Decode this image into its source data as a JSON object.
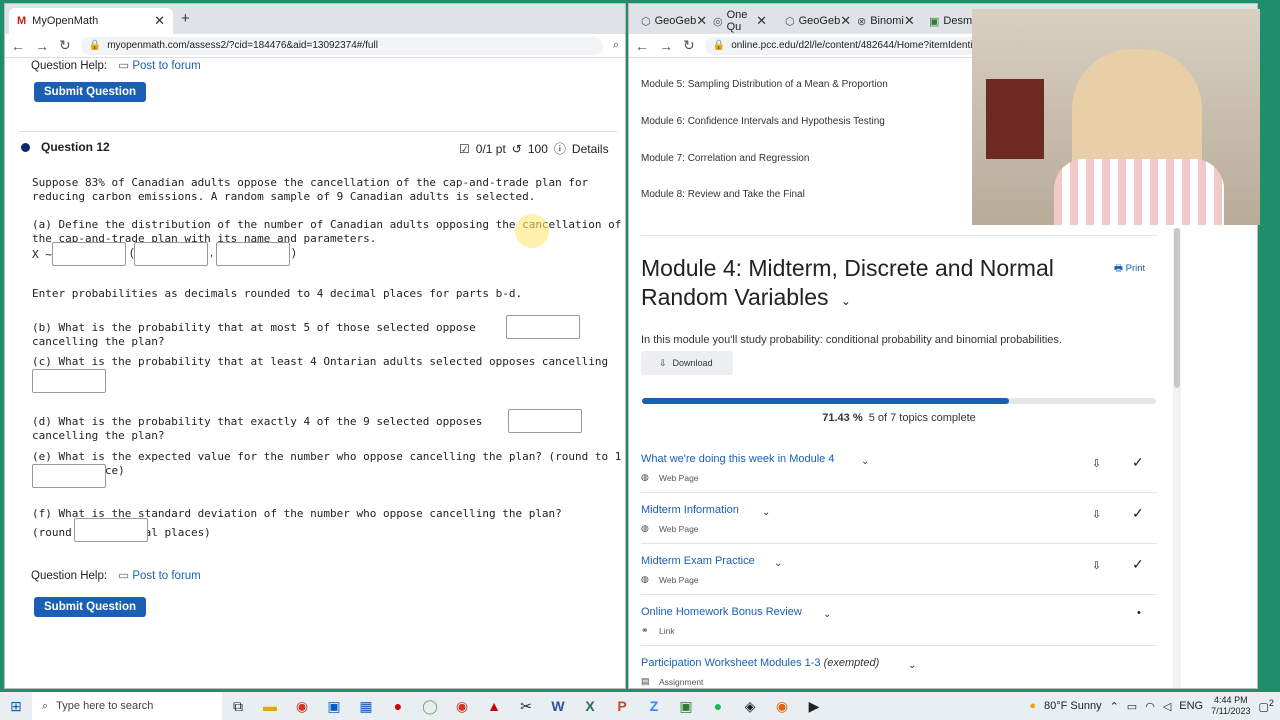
{
  "left_browser": {
    "tab_title": "MyOpenMath",
    "new_tab": "+",
    "url": "myopenmath.com/assess2/?cid=184476&aid=13092374#/full",
    "question_help_top": "Question Help:",
    "post_forum_top": "Post to forum",
    "submit_label_top": "Submit Question",
    "question_title": "Question 12",
    "score": "0/1 pt",
    "tries": "100",
    "details": "Details",
    "intro": "Suppose 83% of Canadian adults oppose the cancellation of the cap-and-trade plan for reducing carbon emissions. A random sample of 9 Canadian adults is selected.",
    "part_a": "(a) Define the distribution of the number of Canadian adults opposing the cancellation of the cap-and-trade plan with its name and parameters.",
    "x_label": "X ~",
    "paren_open": "(",
    "comma": ",",
    "paren_close": ")",
    "instructions": "Enter probabilities as decimals rounded to 4 decimal places for parts b-d.",
    "part_b": "(b) What is the probability that at most 5 of those selected oppose cancelling the plan?",
    "part_c": "(c) What is the probability that at least 4 Ontarian adults selected opposes cancelling the plan?",
    "part_d": "(d) What is the probability that exactly 4 of the 9 selected opposes cancelling the plan?",
    "part_e": "(e) What is the expected value for the number who oppose cancelling the plan? (round to 1 decimal place)",
    "part_f": "(f) What is the standard deviation of the number who oppose cancelling the plan? (round to 2 decimal places)",
    "question_help_bottom": "Question Help:",
    "post_forum_bottom": "Post to forum",
    "submit_label_bottom": "Submit Question"
  },
  "right_browser": {
    "tabs": [
      "GeoGeb",
      "One Qu",
      "GeoGeb",
      "Binomi",
      "Desm"
    ],
    "url": "online.pcc.edu/d2l/le/content/482644/Home?itemIdentifier=",
    "modules": [
      "Module 5: Sampling Distribution of a Mean & Proportion",
      "Module 6: Confidence Intervals and Hypothesis Testing",
      "Module 7: Correlation and Regression",
      "Module 8: Review and Take the Final"
    ],
    "module_title": "Module 4: Midterm, Discrete and Normal Random Variables",
    "print": "Print",
    "description": "In this module you'll study probability: conditional probability and binomial probabilities.",
    "download": "Download",
    "progress_percent": 71.43,
    "progress_text": "71.43 %",
    "progress_detail": "5 of 7 topics complete",
    "topics": [
      {
        "title": "What we're doing this week in Module 4",
        "type": "Web Page",
        "done": true
      },
      {
        "title": "Midterm Information",
        "type": "Web Page",
        "done": true
      },
      {
        "title": "Midterm Exam Practice",
        "type": "Web Page",
        "done": true
      },
      {
        "title": "Online Homework Bonus Review",
        "type": "Link",
        "done": false
      },
      {
        "title": "Participation Worksheet Modules 1-3",
        "exempt": "(exempted)",
        "type": "Assignment",
        "done": false
      }
    ]
  },
  "taskbar": {
    "search_placeholder": "Type here to search",
    "weather": "80°F  Sunny",
    "lang": "ENG",
    "time": "4:44 PM",
    "date": "7/11/2023",
    "notif": "2"
  },
  "colors": {
    "accent": "#1a5fb4",
    "progress": "#1a5fb4",
    "desktop": "#1f8f6b"
  }
}
